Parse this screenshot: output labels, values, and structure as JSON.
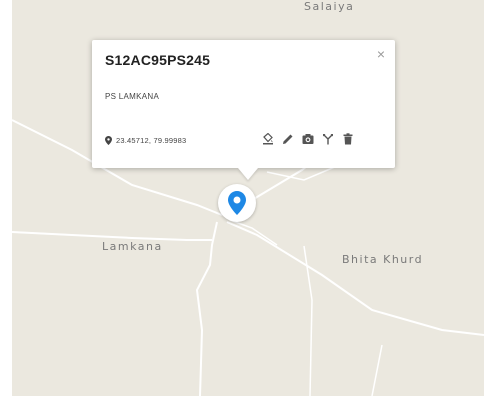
{
  "map": {
    "places": {
      "salaiya": "Salaiya",
      "lamkana": "Lamkana",
      "bhita_khurd": "Bhita Khurd"
    },
    "colors": {
      "land": "#ebe8df",
      "road": "#ffffff",
      "marker": "#1e88e5"
    }
  },
  "popup": {
    "title": "S12AC95PS245",
    "close_label": "×",
    "subtitle": "PS LAMKANA",
    "coordinates": "23.45712, 79.99983",
    "tools": [
      "fill-icon",
      "edit-icon",
      "camera-icon",
      "route-icon",
      "delete-icon"
    ]
  },
  "icons": {
    "location": "location-pin-icon",
    "marker": "map-marker-icon"
  }
}
